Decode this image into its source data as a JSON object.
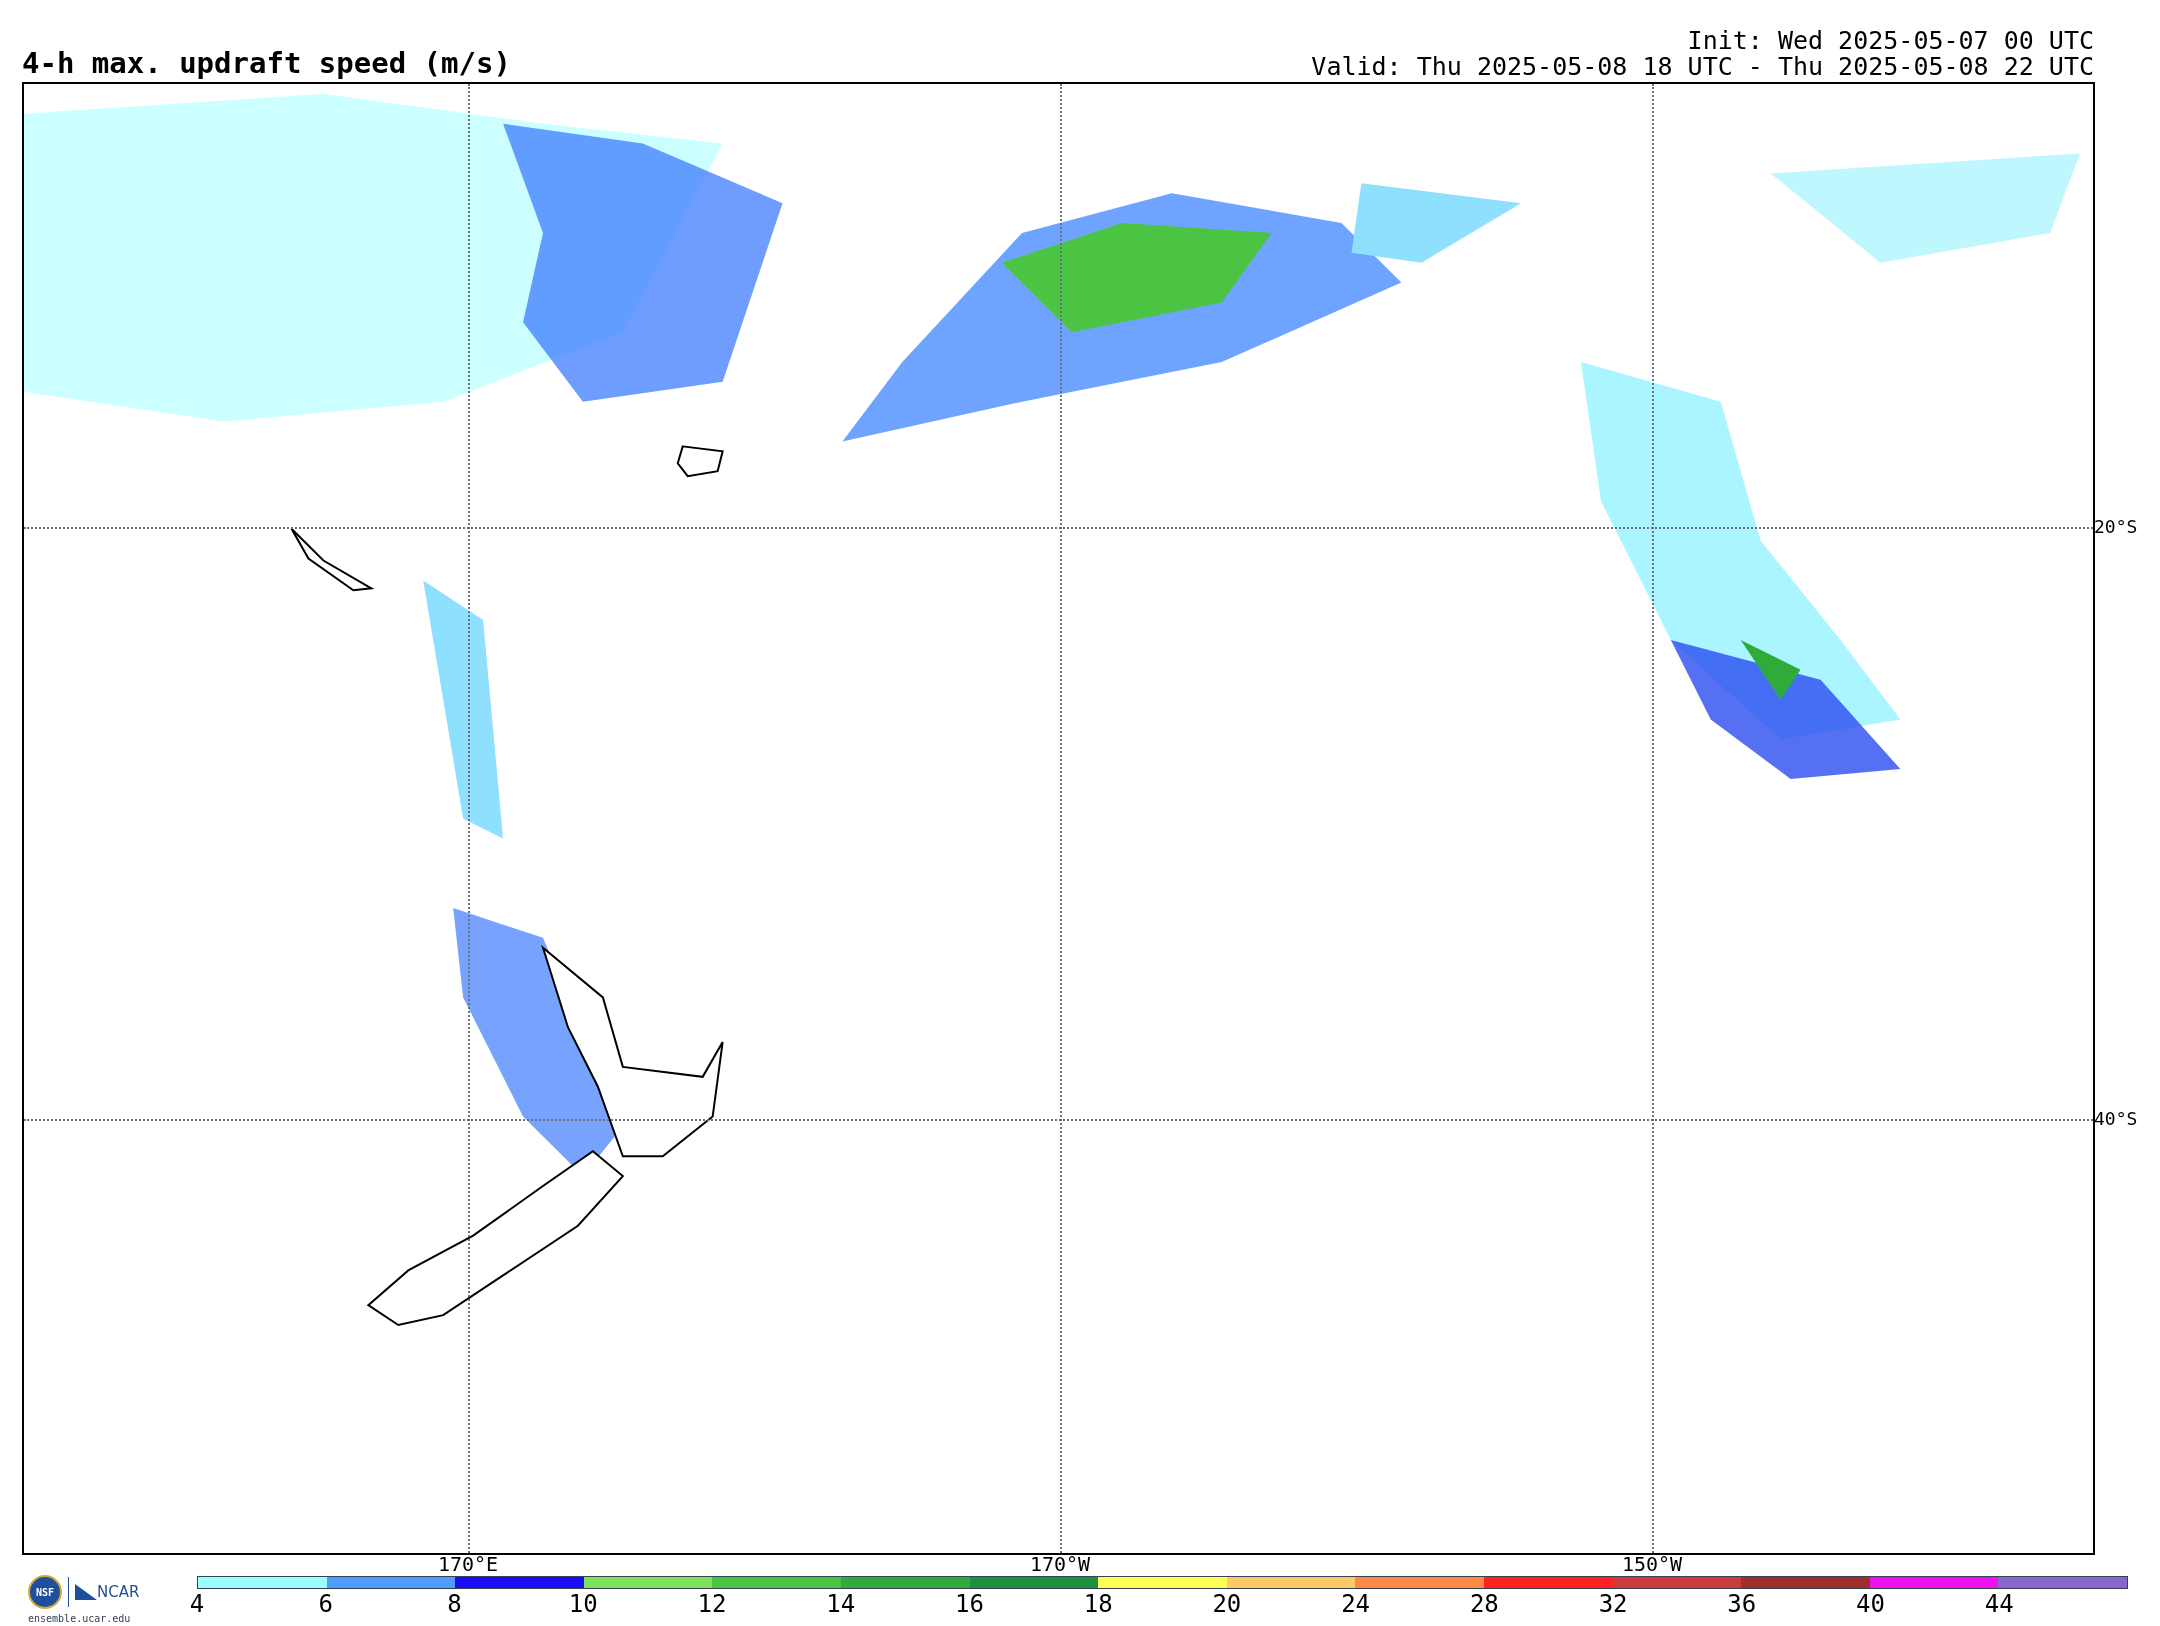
{
  "title": "4-h max. updraft speed (m/s)",
  "init": "Init: Wed 2025-05-07 00 UTC",
  "valid": "Valid: Thu 2025-05-08 18 UTC - Thu 2025-05-08 22 UTC",
  "map": {
    "lat_labels": [
      "20°S",
      "40°S"
    ],
    "lon_labels": [
      "170°E",
      "170°W",
      "150°W"
    ]
  },
  "logo": {
    "nsf": "NSF",
    "ncar": "NCAR",
    "url": "ensemble.ucar.edu"
  },
  "colorbar": [
    {
      "label": "4",
      "color": "#99ffff"
    },
    {
      "label": "6",
      "color": "#4f9bff"
    },
    {
      "label": "8",
      "color": "#1a0cf5"
    },
    {
      "label": "10",
      "color": "#7fe05a"
    },
    {
      "label": "12",
      "color": "#4cc443"
    },
    {
      "label": "14",
      "color": "#2fab3b"
    },
    {
      "label": "16",
      "color": "#1e9140"
    },
    {
      "label": "18",
      "color": "#ffff55"
    },
    {
      "label": "20",
      "color": "#ffca66"
    },
    {
      "label": "24",
      "color": "#ff8844"
    },
    {
      "label": "28",
      "color": "#ff2020"
    },
    {
      "label": "32",
      "color": "#cc3b3b"
    },
    {
      "label": "36",
      "color": "#a02e2e"
    },
    {
      "label": "40",
      "color": "#ee10ee"
    },
    {
      "label": "44",
      "color": "#8866cc"
    }
  ]
}
